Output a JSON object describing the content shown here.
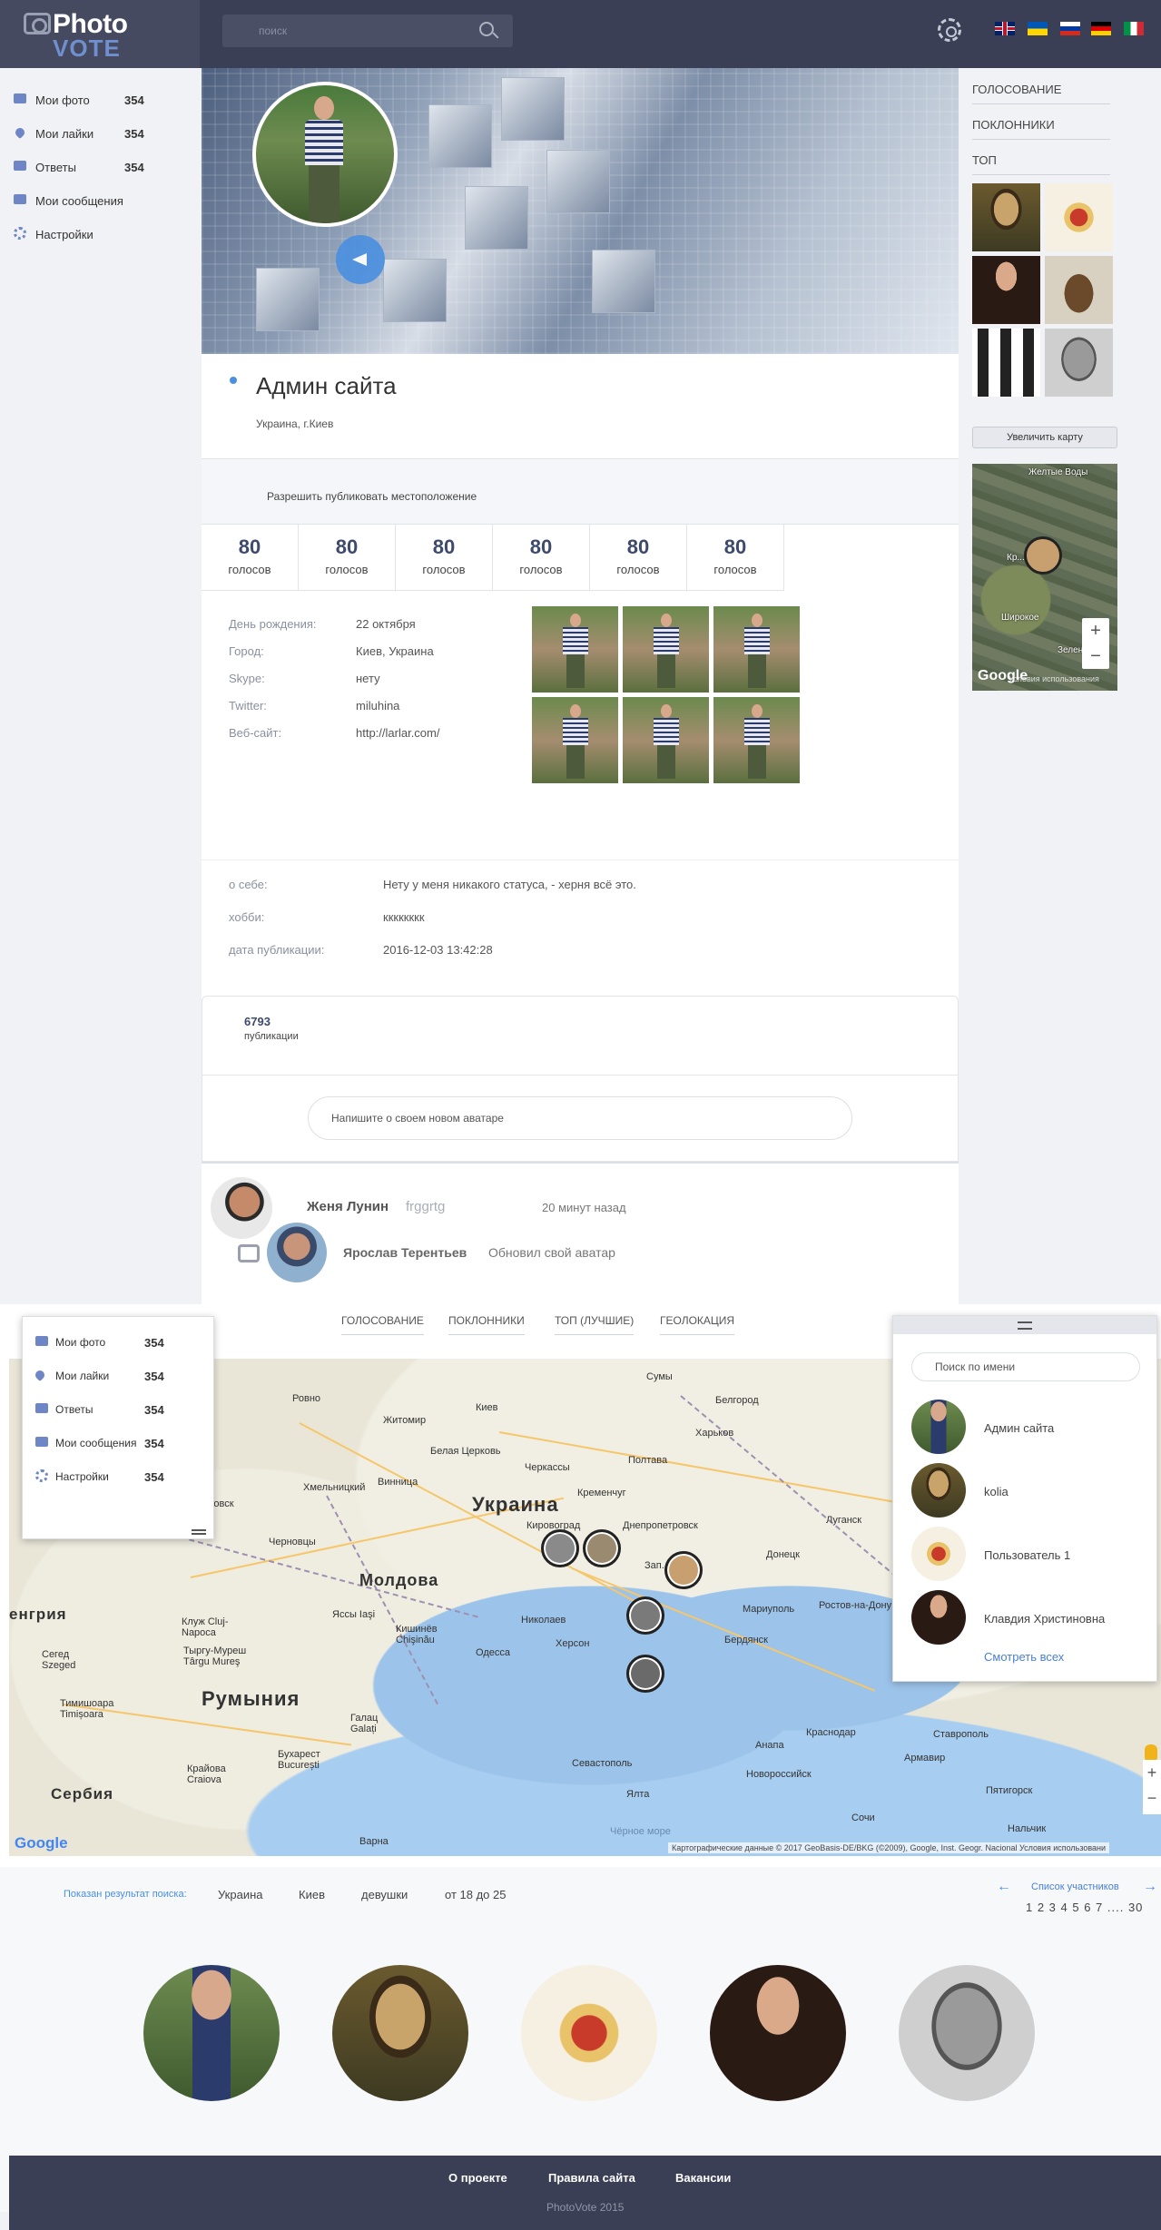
{
  "header": {
    "logo_top": "Photo",
    "logo_bottom": "VOTE",
    "search_placeholder": "поиск",
    "icons": [
      "camera-icon",
      "search-icon",
      "gear-icon"
    ],
    "languages": [
      "uk-flag",
      "ua-flag",
      "ru-flag",
      "de-flag",
      "it-flag"
    ]
  },
  "leftnav": {
    "items": [
      {
        "label": "Мои фото",
        "count": "354",
        "icon": "camera-icon"
      },
      {
        "label": "Мои лайки",
        "count": "354",
        "icon": "heart-icon"
      },
      {
        "label": "Ответы",
        "count": "354",
        "icon": "reply-icon"
      },
      {
        "label": "Мои сообщения",
        "count": "",
        "icon": "message-icon"
      },
      {
        "label": "Настройки",
        "count": "",
        "icon": "gear-icon"
      }
    ]
  },
  "profile": {
    "name": "Админ сайта",
    "location": "Украина, г.Киев",
    "permit_location": "Разрешить публиковать местоположение",
    "votes": [
      {
        "n": "80",
        "t": "голосов"
      },
      {
        "n": "80",
        "t": "голосов"
      },
      {
        "n": "80",
        "t": "голосов"
      },
      {
        "n": "80",
        "t": "голосов"
      },
      {
        "n": "80",
        "t": "голосов"
      },
      {
        "n": "80",
        "t": "голосов"
      }
    ],
    "info": [
      {
        "k": "День рождения:",
        "v": "22 октября"
      },
      {
        "k": "Город:",
        "v": "Киев, Украина"
      },
      {
        "k": "Skype:",
        "v": "нету"
      },
      {
        "k": "Twitter:",
        "v": "miluhina"
      },
      {
        "k": "Веб-сайт:",
        "v": "http://larlar.com/"
      }
    ],
    "about": [
      {
        "k": "о себе:",
        "v": "Нету у меня никакого статуса, - херня всё это."
      },
      {
        "k": "хобби:",
        "v": "кккккккк"
      },
      {
        "k": "дата публикации:",
        "v": "2016-12-03 13:42:28"
      }
    ],
    "publications_count": "6793",
    "publications_label": "публикации",
    "compose_placeholder": "Напишите о своем новом аватаре"
  },
  "feed": {
    "item1": {
      "name": "Женя Лунин",
      "sub": "frggrtg",
      "time": "20 минут назад"
    },
    "item2": {
      "name": "Ярослав Терентьев",
      "sub": "Обновил свой аватар"
    }
  },
  "right": {
    "tabs": [
      "ГОЛОСОВАНИЕ",
      "ПОКЛОННИКИ",
      "ТОП"
    ],
    "zoom_button": "Увеличить карту",
    "minimap": {
      "label1": "Желтые Воды",
      "label2": "Кр...ог",
      "label3": "Широкое",
      "label4": "Зелено...",
      "google": "Google",
      "copy": "Условия использования"
    }
  },
  "map_section": {
    "tabs": [
      "ГОЛОСОВАНИЕ",
      "ПОКЛОННИКИ",
      "ТОП (ЛУЧШИЕ)",
      "ГЕОЛОКАЦИЯ"
    ],
    "labels": {
      "ukraine": "Украина",
      "moldova": "Молдова",
      "romania": "Румыния",
      "serbia": "Сербия",
      "hungary": "енгрия",
      "kiev": "Киев",
      "rovno": "Ровно",
      "zhitomir": "Житомир",
      "sumy": "Сумы",
      "belgorod": "Белгород",
      "kharkov": "Харьков",
      "poltava": "Полтава",
      "cherkassy": "Черкассы",
      "belaya": "Белая Церковь",
      "vinnitsa": "Винница",
      "khmelnitsky": "Хмельницкий",
      "kremenchug": "Кременчуг",
      "kirovograd": "Кировоград",
      "dnepr": "Днепропетровск",
      "lugansk": "Луганск",
      "donetsk": "Донецк",
      "zap": "Зап...",
      "mariupol": "Мариуполь",
      "rostov": "Ростов-на-Дону",
      "nikolaev": "Николаев",
      "kherson": "Херсон",
      "odessa": "Одесса",
      "chisinau": "Кишинёв Chişinău",
      "iasi": "Яссы Iaşi",
      "cluj": "Клуж Cluj-Napoca",
      "targu": "Тыргу-Муреш Târgu Mureş",
      "chernovtsy": "Черновцы",
      "ivano": "о-Франковск",
      "sevastopol": "Севастополь",
      "yalta": "Ялта",
      "krasnodar": "Краснодар",
      "stavropol": "Ставрополь",
      "novoross": "Новороссийск",
      "anapa": "Анапа",
      "sochi": "Сочи",
      "armavir": "Армавир",
      "pyatigorsk": "Пятигорск",
      "nalchik": "Нальчик",
      "bucharest": "Бухарест București",
      "craiova": "Крайова Craiova",
      "galati": "Галац Galați",
      "varna": "Варна",
      "seged": "Сегед Szeged",
      "timisoara": "Тимишоара Timișoara",
      "berdyansk": "Бердянск",
      "black_sea": "Чёрное море"
    },
    "google": "Google",
    "attribution": "Картографические данные © 2017 GeoBasis-DE/BKG (©2009), Google, Inst. Geogr. Nacional   Условия использовани",
    "users_search_placeholder": "Поиск по имени",
    "users": [
      "Админ сайта",
      "kolia",
      "Пользователь 1",
      "Клавдия Христиновна"
    ],
    "see_all": "Смотреть всех"
  },
  "results": {
    "label": "Показан результат поиска:",
    "filters": [
      "Украина",
      "Киев",
      "девушки",
      "от 18 до 25"
    ],
    "list_link": "Список участников",
    "arrow_left": "←",
    "arrow_right": "→",
    "pager": "1 2 3 4 5 6 7 .... 30"
  },
  "footer": {
    "links": [
      "О проекте",
      "Правила сайта",
      "Вакансии"
    ],
    "copyright": "PhotoVote 2015"
  }
}
